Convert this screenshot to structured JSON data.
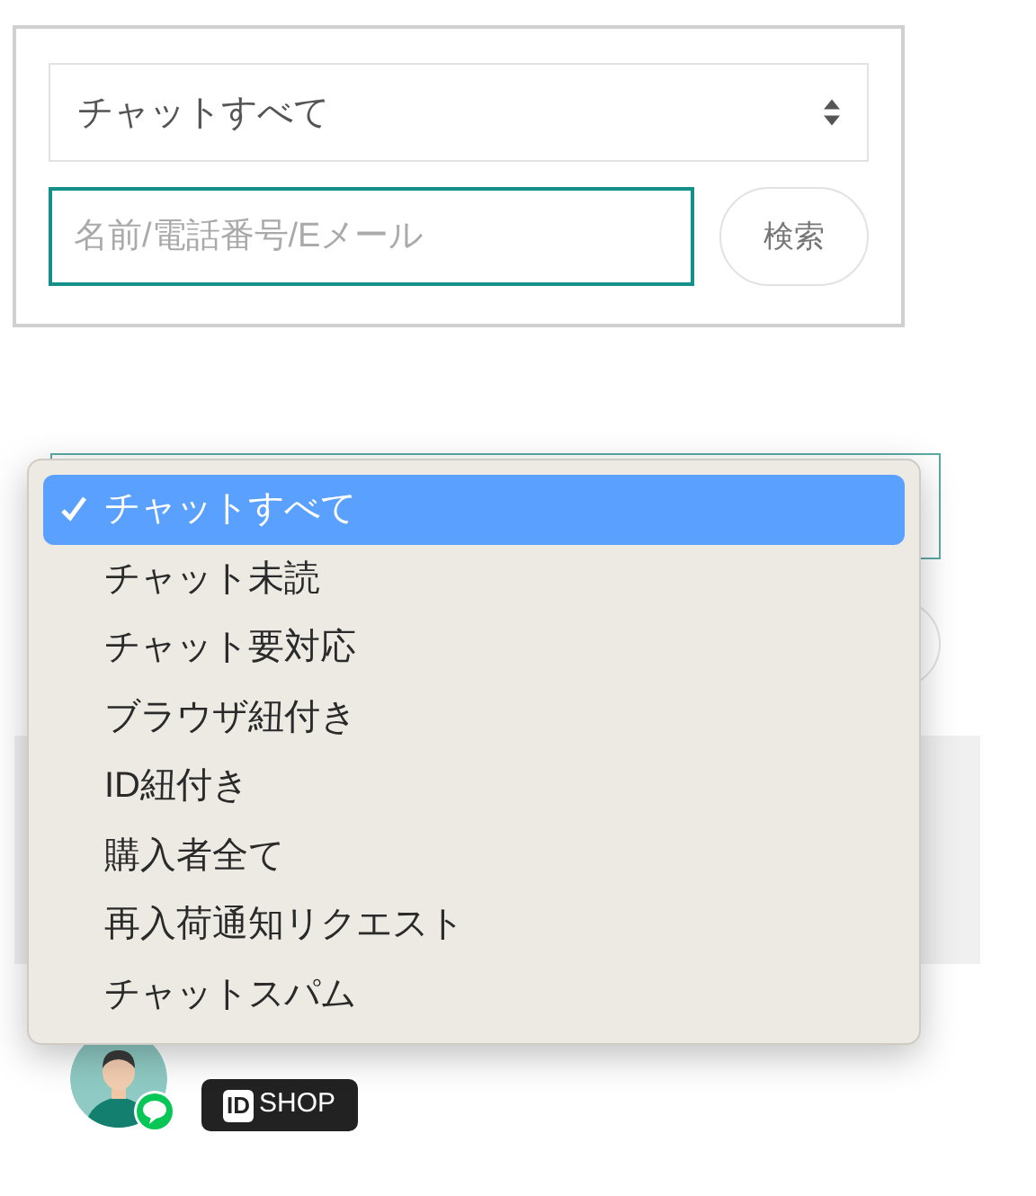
{
  "filter_panel": {
    "select": {
      "value": "チャットすべて"
    },
    "search": {
      "placeholder": "名前/電話番号/Eメール"
    },
    "search_button": "検索"
  },
  "chat_list": {
    "rows": [
      {
        "badge": {
          "id_mark": "ID",
          "label": "SHOP"
        }
      }
    ]
  },
  "filter_menu": {
    "options": [
      {
        "label": "チャットすべて",
        "selected": true
      },
      {
        "label": "チャット未読",
        "selected": false
      },
      {
        "label": "チャット要対応",
        "selected": false
      },
      {
        "label": "ブラウザ紐付き",
        "selected": false
      },
      {
        "label": "ID紐付き",
        "selected": false
      },
      {
        "label": "購入者全て",
        "selected": false
      },
      {
        "label": "再入荷通知リクエスト",
        "selected": false
      },
      {
        "label": "チャットスパム",
        "selected": false
      }
    ]
  }
}
